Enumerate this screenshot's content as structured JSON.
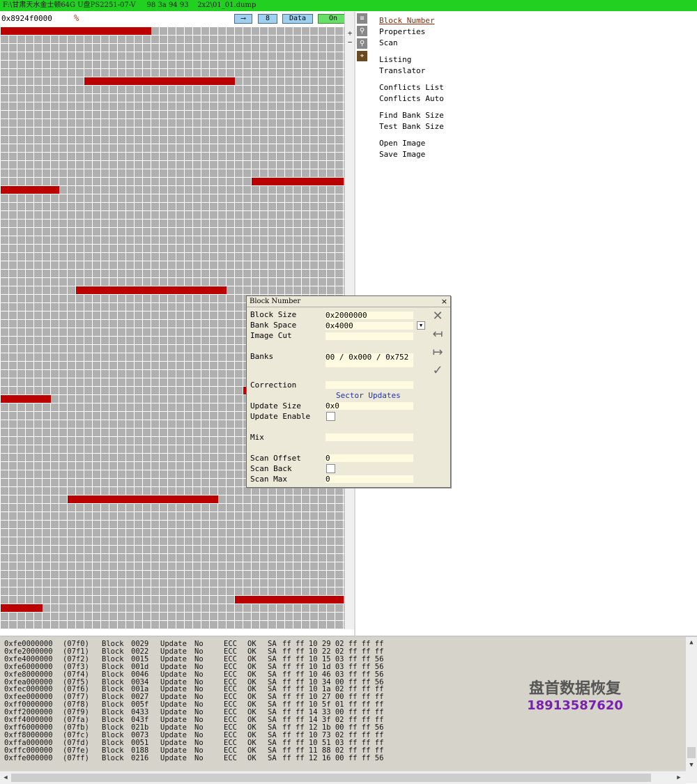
{
  "window": {
    "title": "F:\\甘肃天水金士顿64G U盘PS2251-07-V     98 3a 94 93    2x2\\01_01.dump"
  },
  "toolbar": {
    "address": "0x8924f0000",
    "arrow_btn": "⟶",
    "eight_btn": "8",
    "data_btn": "Data",
    "on_btn": "On"
  },
  "colors": {
    "titlebar": "#22d022",
    "block_marked": "#bb0000",
    "grid_cell": "#b0b0b0",
    "dialog_bg": "#ece9d8",
    "log_bg": "#d6d3ca"
  },
  "side_icons": [
    "list-icon",
    "pin-icon",
    "pin-icon",
    "flag-icon"
  ],
  "menu": {
    "block_number": "Block Number",
    "properties": "Properties",
    "scan": "Scan",
    "listing": "Listing",
    "translator": "Translator",
    "conflicts_list": "Conflicts List",
    "conflicts_auto": "Conflicts Auto",
    "find_bank_size": "Find Bank Size",
    "test_bank_size": "Test Bank Size",
    "open_image": "Open Image",
    "save_image": "Save Image"
  },
  "dialog": {
    "title": "Block Number",
    "block_size_label": "Block Size",
    "block_size": "0x2000000",
    "bank_space_label": "Bank Space",
    "bank_space": "0x4000",
    "image_cut_label": "Image Cut",
    "image_cut": "",
    "banks_label": "Banks",
    "banks": "00 / 0x000 / 0x752",
    "correction_label": "Correction",
    "correction": "",
    "sector_updates": "Sector Updates",
    "update_size_label": "Update Size",
    "update_size": "0x0",
    "update_enable_label": "Update Enable",
    "mix_label": "Mix",
    "mix": "",
    "scan_offset_label": "Scan Offset",
    "scan_offset": "0",
    "scan_back_label": "Scan Back",
    "scan_max_label": "Scan Max",
    "scan_max": "0"
  },
  "log": [
    {
      "addr": "0xfe0000000",
      "idx": "(07f0)",
      "blk": "Block",
      "num": "0029",
      "upd": "Update",
      "updv": "No",
      "ecc": "ECC",
      "eccv": "OK",
      "sa": "SA",
      "bytes": "ff ff 10 29 02 ff ff ff"
    },
    {
      "addr": "0xfe2000000",
      "idx": "(07f1)",
      "blk": "Block",
      "num": "0022",
      "upd": "Update",
      "updv": "No",
      "ecc": "ECC",
      "eccv": "OK",
      "sa": "SA",
      "bytes": "ff ff 10 22 02 ff ff ff"
    },
    {
      "addr": "0xfe4000000",
      "idx": "(07f2)",
      "blk": "Block",
      "num": "0015",
      "upd": "Update",
      "updv": "No",
      "ecc": "ECC",
      "eccv": "OK",
      "sa": "SA",
      "bytes": "ff ff 10 15 03 ff ff 56"
    },
    {
      "addr": "0xfe6000000",
      "idx": "(07f3)",
      "blk": "Block",
      "num": "001d",
      "upd": "Update",
      "updv": "No",
      "ecc": "ECC",
      "eccv": "OK",
      "sa": "SA",
      "bytes": "ff ff 10 1d 03 ff ff 56"
    },
    {
      "addr": "0xfe8000000",
      "idx": "(07f4)",
      "blk": "Block",
      "num": "0046",
      "upd": "Update",
      "updv": "No",
      "ecc": "ECC",
      "eccv": "OK",
      "sa": "SA",
      "bytes": "ff ff 10 46 03 ff ff 56"
    },
    {
      "addr": "0xfea000000",
      "idx": "(07f5)",
      "blk": "Block",
      "num": "0034",
      "upd": "Update",
      "updv": "No",
      "ecc": "ECC",
      "eccv": "OK",
      "sa": "SA",
      "bytes": "ff ff 10 34 00 ff ff 56"
    },
    {
      "addr": "0xfec000000",
      "idx": "(07f6)",
      "blk": "Block",
      "num": "001a",
      "upd": "Update",
      "updv": "No",
      "ecc": "ECC",
      "eccv": "OK",
      "sa": "SA",
      "bytes": "ff ff 10 1a 02 ff ff ff"
    },
    {
      "addr": "0xfee000000",
      "idx": "(07f7)",
      "blk": "Block",
      "num": "0027",
      "upd": "Update",
      "updv": "No",
      "ecc": "ECC",
      "eccv": "OK",
      "sa": "SA",
      "bytes": "ff ff 10 27 00 ff ff ff"
    },
    {
      "addr": "0xff0000000",
      "idx": "(07f8)",
      "blk": "Block",
      "num": "005f",
      "upd": "Update",
      "updv": "No",
      "ecc": "ECC",
      "eccv": "OK",
      "sa": "SA",
      "bytes": "ff ff 10 5f 01 ff ff ff"
    },
    {
      "addr": "0xff2000000",
      "idx": "(07f9)",
      "blk": "Block",
      "num": "0433",
      "upd": "Update",
      "updv": "No",
      "ecc": "ECC",
      "eccv": "OK",
      "sa": "SA",
      "bytes": "ff ff 14 33 00 ff ff ff"
    },
    {
      "addr": "0xff4000000",
      "idx": "(07fa)",
      "blk": "Block",
      "num": "043f",
      "upd": "Update",
      "updv": "No",
      "ecc": "ECC",
      "eccv": "OK",
      "sa": "SA",
      "bytes": "ff ff 14 3f 02 ff ff ff"
    },
    {
      "addr": "0xff6000000",
      "idx": "(07fb)",
      "blk": "Block",
      "num": "021b",
      "upd": "Update",
      "updv": "No",
      "ecc": "ECC",
      "eccv": "OK",
      "sa": "SA",
      "bytes": "ff ff 12 1b 00 ff ff 56"
    },
    {
      "addr": "0xff8000000",
      "idx": "(07fc)",
      "blk": "Block",
      "num": "0073",
      "upd": "Update",
      "updv": "No",
      "ecc": "ECC",
      "eccv": "OK",
      "sa": "SA",
      "bytes": "ff ff 10 73 02 ff ff ff"
    },
    {
      "addr": "0xffa000000",
      "idx": "(07fd)",
      "blk": "Block",
      "num": "0051",
      "upd": "Update",
      "updv": "No",
      "ecc": "ECC",
      "eccv": "OK",
      "sa": "SA",
      "bytes": "ff ff 10 51 03 ff ff ff"
    },
    {
      "addr": "0xffc000000",
      "idx": "(07fe)",
      "blk": "Block",
      "num": "0188",
      "upd": "Update",
      "updv": "No",
      "ecc": "ECC",
      "eccv": "OK",
      "sa": "SA",
      "bytes": "ff ff 11 88 02 ff ff ff"
    },
    {
      "addr": "0xffe000000",
      "idx": "(07ff)",
      "blk": "Block",
      "num": "0216",
      "upd": "Update",
      "updv": "No",
      "ecc": "ECC",
      "eccv": "OK",
      "sa": "SA",
      "bytes": "ff ff 12 16 00 ff ff 56"
    }
  ],
  "watermark": {
    "line1": "盘首数据恢复",
    "line2": "18913587620"
  }
}
